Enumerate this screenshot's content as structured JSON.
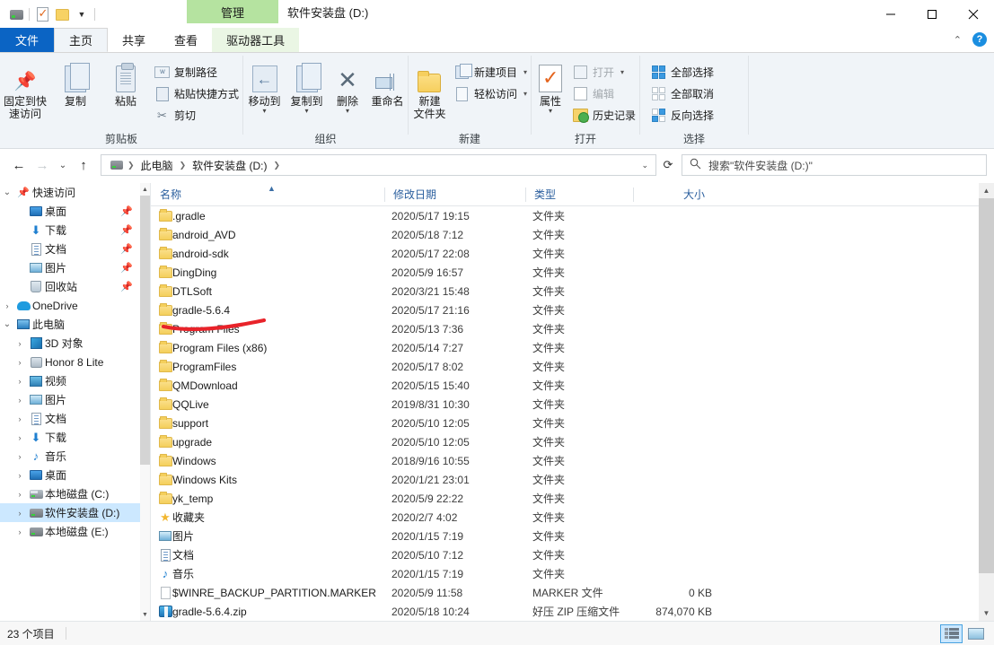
{
  "window": {
    "title": "软件安装盘 (D:)",
    "contextual_tab": "管理",
    "minimize": "—",
    "maximize": "□",
    "close": "✕"
  },
  "quick_access_toolbar": {
    "items": [
      {
        "name": "drive-icon",
        "label": ""
      },
      {
        "name": "properties-icon",
        "label": ""
      },
      {
        "name": "new-folder-icon",
        "label": ""
      },
      {
        "name": "customize-dropdown",
        "label": "▾"
      }
    ]
  },
  "tabs": [
    {
      "id": "file",
      "label": "文件"
    },
    {
      "id": "home",
      "label": "主页"
    },
    {
      "id": "share",
      "label": "共享"
    },
    {
      "id": "view",
      "label": "查看"
    },
    {
      "id": "drive-tools",
      "label": "驱动器工具"
    }
  ],
  "ribbon": {
    "collapse_label": "⌃",
    "help_label": "?",
    "groups": [
      {
        "id": "clipboard",
        "label": "剪贴板",
        "big": [
          {
            "label_line1": "固定到快",
            "label_line2": "速访问",
            "icon": "pin-icon"
          },
          {
            "label_line1": "复制",
            "label_line2": "",
            "icon": "copy-icon"
          },
          {
            "label_line1": "粘贴",
            "label_line2": "",
            "icon": "paste-icon"
          }
        ],
        "small": [
          {
            "label": "复制路径",
            "icon": "copy-path-icon",
            "disabled": false
          },
          {
            "label": "粘贴快捷方式",
            "icon": "paste-shortcut-icon",
            "disabled": false
          },
          {
            "label": "剪切",
            "icon": "scissors-icon",
            "disabled": false
          }
        ]
      },
      {
        "id": "organize",
        "label": "组织",
        "big": [
          {
            "label_line1": "移动到",
            "label_line2": "",
            "icon": "move-to-icon",
            "caret": "▾"
          },
          {
            "label_line1": "复制到",
            "label_line2": "",
            "icon": "copy-to-icon",
            "caret": "▾"
          },
          {
            "label_line1": "删除",
            "label_line2": "",
            "icon": "delete-icon",
            "caret": "▾"
          },
          {
            "label_line1": "重命名",
            "label_line2": "",
            "icon": "rename-icon"
          }
        ]
      },
      {
        "id": "new",
        "label": "新建",
        "big": [
          {
            "label_line1": "新建",
            "label_line2": "文件夹",
            "icon": "new-folder-icon"
          }
        ],
        "small": [
          {
            "label": "新建项目",
            "icon": "new-item-icon",
            "caret": "▾"
          },
          {
            "label": "轻松访问",
            "icon": "easy-access-icon",
            "caret": "▾"
          }
        ]
      },
      {
        "id": "open",
        "label": "打开",
        "big": [
          {
            "label_line1": "属性",
            "label_line2": "",
            "icon": "properties-icon",
            "caret": "▾"
          }
        ],
        "small": [
          {
            "label": "打开",
            "icon": "open-icon",
            "caret": "▾",
            "disabled": true
          },
          {
            "label": "编辑",
            "icon": "edit-icon",
            "disabled": true
          },
          {
            "label": "历史记录",
            "icon": "history-icon",
            "disabled": false
          }
        ]
      },
      {
        "id": "select",
        "label": "选择",
        "small": [
          {
            "label": "全部选择",
            "icon": "select-all-icon"
          },
          {
            "label": "全部取消",
            "icon": "select-none-icon"
          },
          {
            "label": "反向选择",
            "icon": "invert-selection-icon"
          }
        ]
      }
    ]
  },
  "address_bar": {
    "back": "←",
    "forward": "→",
    "recent": "⌄",
    "up": "↑",
    "breadcrumbs": [
      "此电脑",
      "软件安装盘 (D:)"
    ],
    "dropdown": "⌄",
    "refresh": "⟳",
    "search_placeholder": "搜索\"软件安装盘 (D:)\""
  },
  "nav_pane": {
    "items": [
      {
        "label": "快速访问",
        "icon": "quick-access-pin-icon",
        "indent": 0,
        "expander": "⌄",
        "pinned": false,
        "selected": false
      },
      {
        "label": "桌面",
        "icon": "desktop-icon",
        "indent": 1,
        "expander": "",
        "pinned": true,
        "selected": false
      },
      {
        "label": "下载",
        "icon": "downloads-icon",
        "indent": 1,
        "expander": "",
        "pinned": true,
        "selected": false
      },
      {
        "label": "文档",
        "icon": "documents-icon",
        "indent": 1,
        "expander": "",
        "pinned": true,
        "selected": false
      },
      {
        "label": "图片",
        "icon": "pictures-icon",
        "indent": 1,
        "expander": "",
        "pinned": true,
        "selected": false
      },
      {
        "label": "回收站",
        "icon": "recycle-bin-icon",
        "indent": 1,
        "expander": "",
        "pinned": true,
        "selected": false
      },
      {
        "label": "OneDrive",
        "icon": "onedrive-icon",
        "indent": 0,
        "expander": "›",
        "pinned": false,
        "selected": false
      },
      {
        "label": "此电脑",
        "icon": "this-pc-icon",
        "indent": 0,
        "expander": "⌄",
        "pinned": false,
        "selected": false
      },
      {
        "label": "3D 对象",
        "icon": "3d-objects-icon",
        "indent": 1,
        "expander": "›",
        "pinned": false,
        "selected": false
      },
      {
        "label": "Honor 8 Lite",
        "icon": "phone-icon",
        "indent": 1,
        "expander": "›",
        "pinned": false,
        "selected": false
      },
      {
        "label": "视频",
        "icon": "videos-icon",
        "indent": 1,
        "expander": "›",
        "pinned": false,
        "selected": false
      },
      {
        "label": "图片",
        "icon": "pictures-icon",
        "indent": 1,
        "expander": "›",
        "pinned": false,
        "selected": false
      },
      {
        "label": "文档",
        "icon": "documents-icon",
        "indent": 1,
        "expander": "›",
        "pinned": false,
        "selected": false
      },
      {
        "label": "下载",
        "icon": "downloads-icon",
        "indent": 1,
        "expander": "›",
        "pinned": false,
        "selected": false
      },
      {
        "label": "音乐",
        "icon": "music-icon",
        "indent": 1,
        "expander": "›",
        "pinned": false,
        "selected": false
      },
      {
        "label": "桌面",
        "icon": "desktop-icon",
        "indent": 1,
        "expander": "›",
        "pinned": false,
        "selected": false
      },
      {
        "label": "本地磁盘 (C:)",
        "icon": "system-drive-icon",
        "indent": 1,
        "expander": "›",
        "pinned": false,
        "selected": false
      },
      {
        "label": "软件安装盘 (D:)",
        "icon": "drive-icon",
        "indent": 1,
        "expander": "›",
        "pinned": false,
        "selected": true
      },
      {
        "label": "本地磁盘 (E:)",
        "icon": "drive-icon",
        "indent": 1,
        "expander": "›",
        "pinned": false,
        "selected": false
      }
    ]
  },
  "file_list": {
    "columns": [
      {
        "key": "name",
        "label": "名称",
        "sort": "▲"
      },
      {
        "key": "date",
        "label": "修改日期",
        "sort": ""
      },
      {
        "key": "type",
        "label": "类型",
        "sort": ""
      },
      {
        "key": "size",
        "label": "大小",
        "sort": ""
      }
    ],
    "rows": [
      {
        "name": ".gradle",
        "date": "2020/5/17 19:15",
        "type": "文件夹",
        "size": "",
        "icon": "folder-icon"
      },
      {
        "name": "android_AVD",
        "date": "2020/5/18 7:12",
        "type": "文件夹",
        "size": "",
        "icon": "folder-icon"
      },
      {
        "name": "android-sdk",
        "date": "2020/5/17 22:08",
        "type": "文件夹",
        "size": "",
        "icon": "folder-icon"
      },
      {
        "name": "DingDing",
        "date": "2020/5/9 16:57",
        "type": "文件夹",
        "size": "",
        "icon": "folder-icon"
      },
      {
        "name": "DTLSoft",
        "date": "2020/3/21 15:48",
        "type": "文件夹",
        "size": "",
        "icon": "folder-icon"
      },
      {
        "name": "gradle-5.6.4",
        "date": "2020/5/17 21:16",
        "type": "文件夹",
        "size": "",
        "icon": "folder-icon"
      },
      {
        "name": "Program Files",
        "date": "2020/5/13 7:36",
        "type": "文件夹",
        "size": "",
        "icon": "folder-icon"
      },
      {
        "name": "Program Files (x86)",
        "date": "2020/5/14 7:27",
        "type": "文件夹",
        "size": "",
        "icon": "folder-icon"
      },
      {
        "name": "ProgramFiles",
        "date": "2020/5/17 8:02",
        "type": "文件夹",
        "size": "",
        "icon": "folder-icon"
      },
      {
        "name": "QMDownload",
        "date": "2020/5/15 15:40",
        "type": "文件夹",
        "size": "",
        "icon": "folder-icon"
      },
      {
        "name": "QQLive",
        "date": "2019/8/31 10:30",
        "type": "文件夹",
        "size": "",
        "icon": "folder-icon"
      },
      {
        "name": "support",
        "date": "2020/5/10 12:05",
        "type": "文件夹",
        "size": "",
        "icon": "folder-icon"
      },
      {
        "name": "upgrade",
        "date": "2020/5/10 12:05",
        "type": "文件夹",
        "size": "",
        "icon": "folder-icon"
      },
      {
        "name": "Windows",
        "date": "2018/9/16 10:55",
        "type": "文件夹",
        "size": "",
        "icon": "folder-icon"
      },
      {
        "name": "Windows Kits",
        "date": "2020/1/21 23:01",
        "type": "文件夹",
        "size": "",
        "icon": "folder-icon"
      },
      {
        "name": "yk_temp",
        "date": "2020/5/9 22:22",
        "type": "文件夹",
        "size": "",
        "icon": "folder-icon"
      },
      {
        "name": "收藏夹",
        "date": "2020/2/7 4:02",
        "type": "文件夹",
        "size": "",
        "icon": "favorites-star-icon"
      },
      {
        "name": "图片",
        "date": "2020/1/15 7:19",
        "type": "文件夹",
        "size": "",
        "icon": "pictures-icon"
      },
      {
        "name": "文档",
        "date": "2020/5/10 7:12",
        "type": "文件夹",
        "size": "",
        "icon": "documents-icon"
      },
      {
        "name": "音乐",
        "date": "2020/1/15 7:19",
        "type": "文件夹",
        "size": "",
        "icon": "music-icon"
      },
      {
        "name": "$WINRE_BACKUP_PARTITION.MARKER",
        "date": "2020/5/9 11:58",
        "type": "MARKER 文件",
        "size": "0 KB",
        "icon": "file-icon"
      },
      {
        "name": "gradle-5.6.4.zip",
        "date": "2020/5/18 10:24",
        "type": "好压 ZIP 压缩文件",
        "size": "874,070 KB",
        "icon": "zip-icon"
      }
    ]
  },
  "annotation": {
    "type": "freehand-underline",
    "color": "#e8232a",
    "targets": "gradle-5.6.4"
  },
  "status_bar": {
    "item_count": "23 个项目",
    "views": [
      {
        "name": "details-view",
        "label": "",
        "active": true
      },
      {
        "name": "large-icons-view",
        "label": "",
        "active": false
      }
    ]
  }
}
